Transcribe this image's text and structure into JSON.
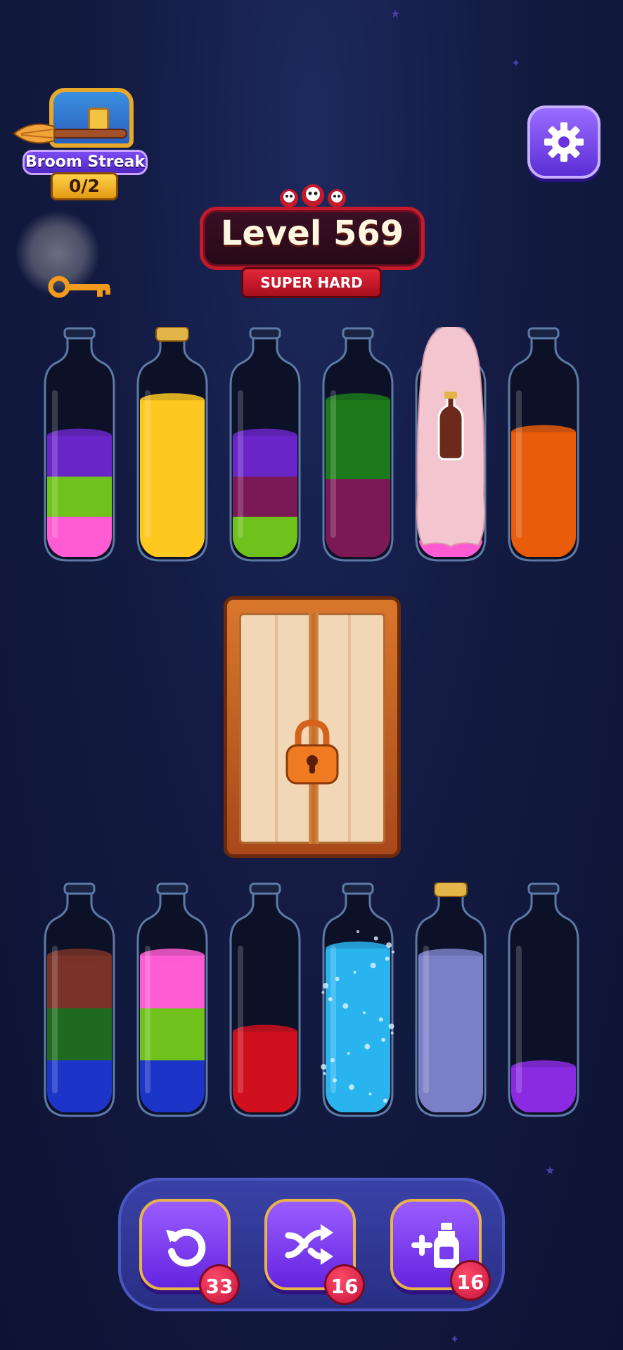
{
  "broom_streak": {
    "label": "Broom Streak",
    "progress": "0/2"
  },
  "level": {
    "title": "Level 569",
    "difficulty": "SUPER HARD"
  },
  "bottles_top": [
    {
      "id": "b1",
      "layers": [
        "#ff5bd2",
        "#6fc21c",
        "#6a25c8"
      ],
      "level": 0.68,
      "cork": false
    },
    {
      "id": "b2",
      "layers": [
        "#ffc821"
      ],
      "level": 0.88,
      "cork": true
    },
    {
      "id": "b3",
      "layers": [
        "#6fc21c",
        "#7b1856",
        "#6a25c8"
      ],
      "level": 0.68,
      "cork": false
    },
    {
      "id": "b4",
      "layers": [
        "#7b1856",
        "#1d7a1a"
      ],
      "level": 0.88,
      "cork": false
    },
    {
      "id": "b5",
      "layers": [
        "#ff5bd2"
      ],
      "level": 0.08,
      "cork": false,
      "covered": true
    },
    {
      "id": "b6",
      "layers": [
        "#e85c0c"
      ],
      "level": 0.7,
      "cork": false
    }
  ],
  "bottles_bottom": [
    {
      "id": "b7",
      "layers": [
        "#1d34c9",
        "#1e6a20",
        "#7a3328"
      ],
      "level": 0.88,
      "cork": false
    },
    {
      "id": "b8",
      "layers": [
        "#1d34c9",
        "#6fc21c",
        "#ff5bd2"
      ],
      "level": 0.88,
      "cork": false
    },
    {
      "id": "b9",
      "layers": [
        "#d0101e"
      ],
      "level": 0.45,
      "cork": false
    },
    {
      "id": "b10",
      "layers": [
        "#29b4f0"
      ],
      "level": 0.92,
      "cork": false,
      "sparkle": true
    },
    {
      "id": "b11",
      "layers": [
        "#7a80c8"
      ],
      "level": 0.88,
      "cork": true
    },
    {
      "id": "b12",
      "layers": [
        "#8a2be2"
      ],
      "level": 0.25,
      "cork": false
    }
  ],
  "tools": {
    "undo": {
      "count": "33"
    },
    "shuffle": {
      "count": "16"
    },
    "add_bottle": {
      "count": "16"
    }
  },
  "colors": {
    "accent": "#7a3cf0",
    "danger": "#c41a2b",
    "gold": "#e8b44a"
  }
}
